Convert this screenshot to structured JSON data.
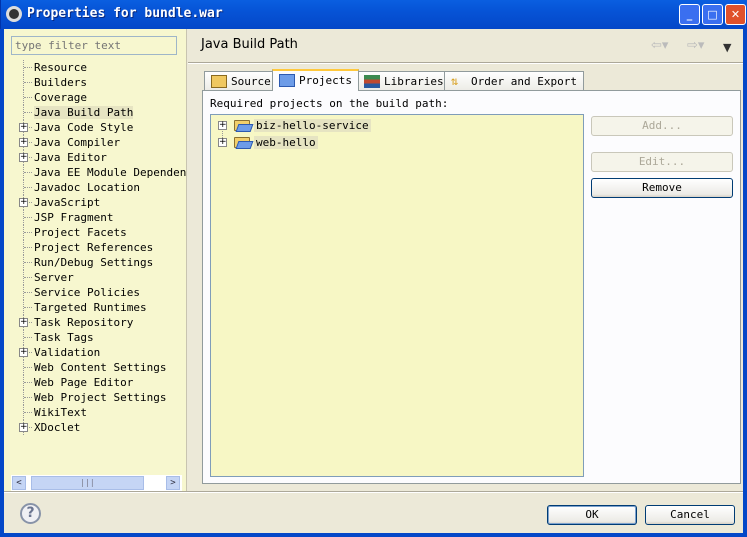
{
  "window": {
    "title": "Properties for bundle.war",
    "minimize": "_",
    "maximize": "□",
    "close": "✕"
  },
  "sidebar": {
    "filter_placeholder": "type filter text",
    "items": [
      {
        "label": "Resource",
        "expandable": false
      },
      {
        "label": "Builders",
        "expandable": false
      },
      {
        "label": "Coverage",
        "expandable": false
      },
      {
        "label": "Java Build Path",
        "expandable": false,
        "selected": true
      },
      {
        "label": "Java Code Style",
        "expandable": true
      },
      {
        "label": "Java Compiler",
        "expandable": true
      },
      {
        "label": "Java Editor",
        "expandable": true
      },
      {
        "label": "Java EE Module Dependencies",
        "expandable": false
      },
      {
        "label": "Javadoc Location",
        "expandable": false
      },
      {
        "label": "JavaScript",
        "expandable": true
      },
      {
        "label": "JSP Fragment",
        "expandable": false
      },
      {
        "label": "Project Facets",
        "expandable": false
      },
      {
        "label": "Project References",
        "expandable": false
      },
      {
        "label": "Run/Debug Settings",
        "expandable": false
      },
      {
        "label": "Server",
        "expandable": false
      },
      {
        "label": "Service Policies",
        "expandable": false
      },
      {
        "label": "Targeted Runtimes",
        "expandable": false
      },
      {
        "label": "Task Repository",
        "expandable": true
      },
      {
        "label": "Task Tags",
        "expandable": false
      },
      {
        "label": "Validation",
        "expandable": true
      },
      {
        "label": "Web Content Settings",
        "expandable": false
      },
      {
        "label": "Web Page Editor",
        "expandable": false
      },
      {
        "label": "Web Project Settings",
        "expandable": false
      },
      {
        "label": "WikiText",
        "expandable": false
      },
      {
        "label": "XDoclet",
        "expandable": true
      }
    ]
  },
  "main": {
    "title": "Java Build Path",
    "tabs": [
      {
        "label": "Source"
      },
      {
        "label": "Projects",
        "active": true
      },
      {
        "label": "Libraries"
      },
      {
        "label": "Order and Export"
      }
    ],
    "required_label": "Required projects on the build path:",
    "projects": [
      "biz-hello-service",
      "web-hello"
    ],
    "buttons": {
      "add": "Add...",
      "edit": "Edit...",
      "remove": "Remove"
    }
  },
  "footer": {
    "ok": "OK",
    "cancel": "Cancel",
    "help": "?"
  }
}
